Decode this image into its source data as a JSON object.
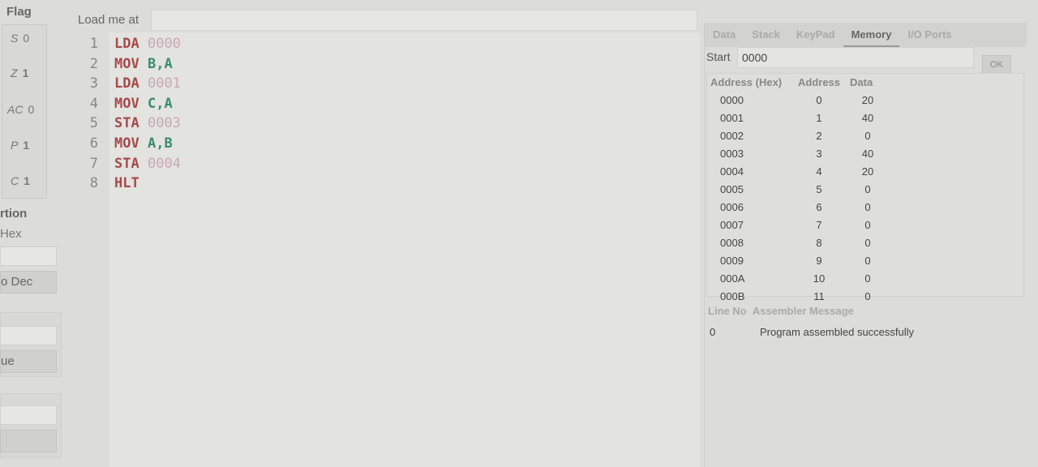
{
  "flags": {
    "title": "Flag",
    "items": [
      {
        "name": "S",
        "value": "0"
      },
      {
        "name": "Z",
        "value": "1"
      },
      {
        "name": "AC",
        "value": "0"
      },
      {
        "name": "P",
        "value": "1"
      },
      {
        "name": "C",
        "value": "1"
      }
    ]
  },
  "conversion": {
    "title": "rtion",
    "subtitle": "Hex",
    "button1": "o Dec",
    "button2": "ue"
  },
  "load": {
    "label": "Load me at",
    "value": ""
  },
  "code": [
    {
      "n": "1",
      "op": "LDA",
      "arg": "0000",
      "type": "addr"
    },
    {
      "n": "2",
      "op": "MOV",
      "arg": "B,A",
      "type": "reg"
    },
    {
      "n": "3",
      "op": "LDA",
      "arg": "0001",
      "type": "addr"
    },
    {
      "n": "4",
      "op": "MOV",
      "arg": "C,A",
      "type": "reg"
    },
    {
      "n": "5",
      "op": "STA",
      "arg": "0003",
      "type": "addr"
    },
    {
      "n": "6",
      "op": "MOV",
      "arg": "A,B",
      "type": "reg"
    },
    {
      "n": "7",
      "op": "STA",
      "arg": "0004",
      "type": "addr"
    },
    {
      "n": "8",
      "op": "HLT",
      "arg": "",
      "type": "reg"
    }
  ],
  "tabs": [
    "Data",
    "Stack",
    "KeyPad",
    "Memory",
    "I/O Ports"
  ],
  "memory": {
    "start_label": "Start",
    "start_value": "0000",
    "ok": "OK",
    "headers": [
      "Address (Hex)",
      "Address",
      "Data"
    ],
    "rows": [
      [
        "0000",
        "0",
        "20"
      ],
      [
        "0001",
        "1",
        "40"
      ],
      [
        "0002",
        "2",
        "0"
      ],
      [
        "0003",
        "3",
        "40"
      ],
      [
        "0004",
        "4",
        "20"
      ],
      [
        "0005",
        "5",
        "0"
      ],
      [
        "0006",
        "6",
        "0"
      ],
      [
        "0007",
        "7",
        "0"
      ],
      [
        "0008",
        "8",
        "0"
      ],
      [
        "0009",
        "9",
        "0"
      ],
      [
        "000A",
        "10",
        "0"
      ],
      [
        "000B",
        "11",
        "0"
      ]
    ]
  },
  "messages": {
    "headers": [
      "Line No",
      "Assembler Message"
    ],
    "rows": [
      [
        "0",
        "Program assembled successfully"
      ]
    ]
  }
}
